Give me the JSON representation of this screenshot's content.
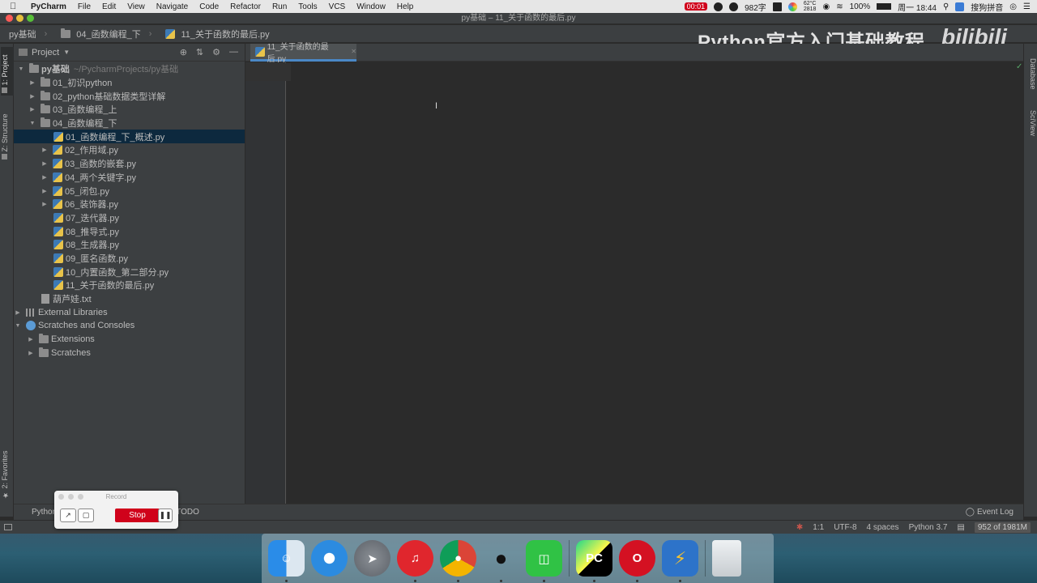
{
  "menubar": {
    "app": "PyCharm",
    "items": [
      "File",
      "Edit",
      "View",
      "Navigate",
      "Code",
      "Refactor",
      "Run",
      "Tools",
      "VCS",
      "Window",
      "Help"
    ],
    "record_time": "00:01",
    "word_count": "982字",
    "temp_top": "62°C",
    "temp_bottom": "2818",
    "battery": "100%",
    "clock": "周一 18:44",
    "input_method": "搜狗拼音"
  },
  "window": {
    "title": "py基础 – 11_关于函数的最后.py"
  },
  "breadcrumb": [
    "py基础",
    "04_函数编程_下",
    "11_关于函数的最后.py"
  ],
  "watermark": {
    "text": "Python官方入门基础教程",
    "logo": "bilibili"
  },
  "left_tabs": {
    "project": "1: Project",
    "structure": "Z: Structure",
    "favorites": "2: Favorites"
  },
  "right_tabs": {
    "database": "Database",
    "sciview": "SciView"
  },
  "project_panel": {
    "title": "Project",
    "root": {
      "name": "py基础",
      "path": "~/PycharmProjects/py基础"
    },
    "folders": [
      "01_初识python",
      "02_python基础数据类型详解",
      "03_函数编程_上",
      "04_函数编程_下"
    ],
    "files": [
      "01_函数编程_下_概述.py",
      "02_作用域.py",
      "03_函数的嵌套.py",
      "04_两个关键字.py",
      "05_闭包.py",
      "06_装饰器.py",
      "07_迭代器.py",
      "08_推导式.py",
      "08_生成器.py",
      "09_匿名函数.py",
      "10_内置函数_第二部分.py",
      "11_关于函数的最后.py"
    ],
    "txt_file": "葫芦娃.txt",
    "external_libraries": "External Libraries",
    "scratches_root": "Scratches and Consoles",
    "scratch_children": [
      "Extensions",
      "Scratches"
    ]
  },
  "editor": {
    "tab_label": "11_关于函数的最后.py"
  },
  "bottom_tools": {
    "python_console": "Python",
    "todo": "TODO",
    "event_log": "Event Log"
  },
  "status_bar": {
    "position": "1:1",
    "encoding": "UTF-8",
    "indent": "4 spaces",
    "interpreter": "Python 3.7",
    "memory": "952 of 1981M"
  },
  "record_widget": {
    "title": "Record",
    "stop_label": "Stop"
  },
  "dock": {
    "apps": [
      "Finder",
      "Safari",
      "Launchpad",
      "NetEase Music",
      "Chrome",
      "QQ",
      "WeChat",
      "PyCharm",
      "Opera",
      "Reeder",
      "Trash"
    ]
  },
  "colors": {
    "accent": "#4a88c7",
    "selection": "#0d293e",
    "editor_bg": "#2b2b2b",
    "panel_bg": "#3c3f41",
    "stop_red": "#d0021b"
  }
}
